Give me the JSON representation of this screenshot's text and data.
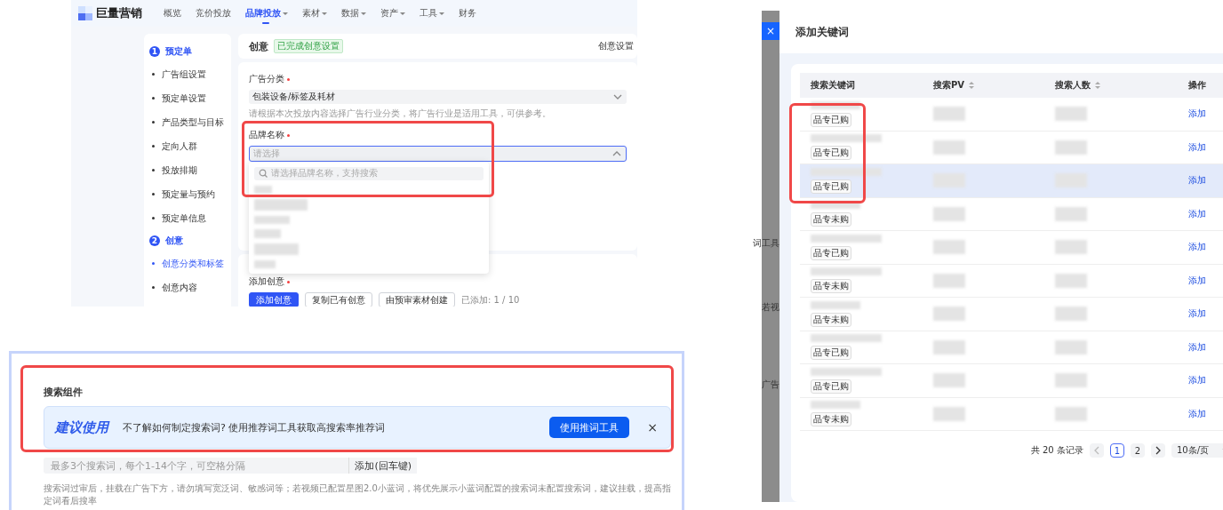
{
  "brand_screen": {
    "logo": "巨量营销",
    "nav": [
      {
        "label": "概览",
        "selected": false,
        "dropdown": false
      },
      {
        "label": "竞价投放",
        "selected": false,
        "dropdown": false
      },
      {
        "label": "品牌投放",
        "selected": true,
        "dropdown": true
      },
      {
        "label": "素材",
        "selected": false,
        "dropdown": true
      },
      {
        "label": "数据",
        "selected": false,
        "dropdown": true
      },
      {
        "label": "资产",
        "selected": false,
        "dropdown": true
      },
      {
        "label": "工具",
        "selected": false,
        "dropdown": true
      },
      {
        "label": "财务",
        "selected": false,
        "dropdown": false
      }
    ],
    "steps": [
      {
        "number": "1",
        "title": "预定单",
        "items": [
          {
            "label": "广告组设置",
            "selected": false
          },
          {
            "label": "预定单设置",
            "selected": false
          },
          {
            "label": "产品类型与目标",
            "selected": false
          },
          {
            "label": "定向人群",
            "selected": false
          },
          {
            "label": "投放排期",
            "selected": false
          },
          {
            "label": "预定量与预约",
            "selected": false
          },
          {
            "label": "预定单信息",
            "selected": false
          }
        ]
      },
      {
        "number": "2",
        "title": "创意",
        "items": [
          {
            "label": "创意分类和标签",
            "selected": true
          },
          {
            "label": "创意内容",
            "selected": false
          }
        ]
      }
    ],
    "header": {
      "title": "创意",
      "badge": "已完成创意设置",
      "action": "创意设置"
    },
    "category": {
      "label": "广告分类",
      "required": true,
      "value": "包装设备/标签及耗材",
      "hint": "请根据本次投放内容选择广告行业分类，将广告行业是适用工具，可供参考。"
    },
    "brand": {
      "label": "品牌名称",
      "required": true,
      "placeholder": "请选择",
      "expanded": true,
      "outlined": true,
      "search_placeholder": "请选择品牌名称，支持搜索"
    },
    "creatives": {
      "label": "添加创意",
      "required": true,
      "buttons": [
        {
          "label": "添加创意",
          "primary": true
        },
        {
          "label": "复制已有创意",
          "primary": false
        },
        {
          "label": "由预审素材创建",
          "primary": false
        }
      ],
      "count": "已添加: 1 / 10"
    }
  },
  "search_screen": {
    "title": "搜索组件",
    "banner": {
      "tag": "建议使用",
      "text": "不了解如何制定搜索词? 使用推荐词工具获取高搜索率推荐词",
      "button": "使用推词工具",
      "close": "×",
      "outlined": true
    },
    "input": {
      "placeholder": "最多3个搜索词，每个1-14个字，可空格分隔",
      "button": "添加(回车键)"
    },
    "hint": "搜索词过审后，挂载在广告下方，请勿填写宽泛词、敏感词等；若视频已配置星图2.0小蓝词，将优先展示小蓝词配置的搜索词未配置搜索词，建议挂载，提高指定词看后搜率"
  },
  "keyword_screen": {
    "close": "×",
    "backdrop_texts": [
      "词工具",
      "若视",
      "广告"
    ],
    "title": "添加关键词",
    "columns": [
      {
        "label": "搜索关键词",
        "sortable": false
      },
      {
        "label": "搜索PV",
        "sortable": true
      },
      {
        "label": "搜索人数",
        "sortable": true
      },
      {
        "label": "操作",
        "sortable": false
      }
    ],
    "rows": [
      {
        "tag": "品专已购",
        "action": "添加",
        "highlighted": false,
        "outlined": true
      },
      {
        "tag": "品专已购",
        "action": "添加",
        "highlighted": false,
        "outlined": true
      },
      {
        "tag": "品专已购",
        "action": "添加",
        "highlighted": true,
        "outlined": true
      },
      {
        "tag": "品专未购",
        "action": "添加",
        "highlighted": false,
        "outlined": false
      },
      {
        "tag": "品专已购",
        "action": "添加",
        "highlighted": false,
        "outlined": false
      },
      {
        "tag": "品专未购",
        "action": "添加",
        "highlighted": false,
        "outlined": false
      },
      {
        "tag": "品专未购",
        "action": "添加",
        "highlighted": false,
        "outlined": false
      },
      {
        "tag": "品专已购",
        "action": "添加",
        "highlighted": false,
        "outlined": false
      },
      {
        "tag": "品专已购",
        "action": "添加",
        "highlighted": false,
        "outlined": false
      },
      {
        "tag": "品专未购",
        "action": "添加",
        "highlighted": false,
        "outlined": false
      }
    ],
    "pagination": {
      "total": "共 20 条记录",
      "pages": [
        {
          "label": "1",
          "selected": true
        },
        {
          "label": "2",
          "selected": false
        }
      ],
      "page_size": "10条/页"
    }
  }
}
